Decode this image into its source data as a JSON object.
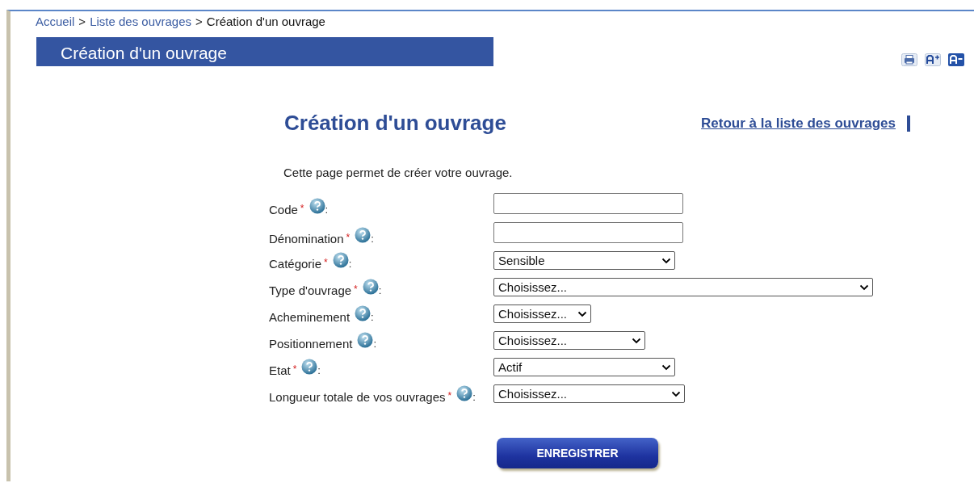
{
  "breadcrumb": [
    {
      "label": "Accueil",
      "link": true
    },
    {
      "label": "Liste des ouvrages",
      "link": true
    },
    {
      "label": "Création d'un ouvrage",
      "link": false
    }
  ],
  "breadcrumb_separator": ">",
  "banner_title": "Création d'un ouvrage",
  "page_title": "Création d'un ouvrage",
  "back_link": "Retour à la liste des ouvrages",
  "intro": "Cette page permet de créer votre ouvrage.",
  "fields": [
    {
      "label": "Code",
      "required": true,
      "kind": "text"
    },
    {
      "label": "Dénomination",
      "required": true,
      "kind": "text"
    },
    {
      "label": "Catégorie",
      "required": true,
      "kind": "select",
      "value": "Sensible"
    },
    {
      "label": "Type d'ouvrage",
      "required": true,
      "kind": "select",
      "value": "Choisissez..."
    },
    {
      "label": "Acheminement",
      "required": false,
      "kind": "select",
      "value": "Choisissez..."
    },
    {
      "label": "Positionnement",
      "required": false,
      "kind": "select",
      "value": "Choisissez..."
    },
    {
      "label": "Etat",
      "required": true,
      "kind": "select",
      "value": "Actif"
    },
    {
      "label": "Longueur totale de vos ouvrages",
      "required": true,
      "kind": "select",
      "value": "Choisissez..."
    }
  ],
  "required_mark": "*",
  "label_suffix": ":",
  "submit": "ENREGISTRER"
}
